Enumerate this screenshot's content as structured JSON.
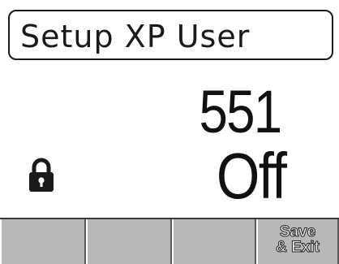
{
  "header": {
    "title": "Setup XP User"
  },
  "main": {
    "value": "551",
    "state": "Off",
    "lock_icon": "lock-icon"
  },
  "softkeys": [
    {
      "label": ""
    },
    {
      "label": ""
    },
    {
      "label": ""
    },
    {
      "label": "Save\n& Exit"
    }
  ],
  "colors": {
    "background": "#ffffff",
    "softkey_bar": "#b4b4b4",
    "text": "#111111"
  }
}
